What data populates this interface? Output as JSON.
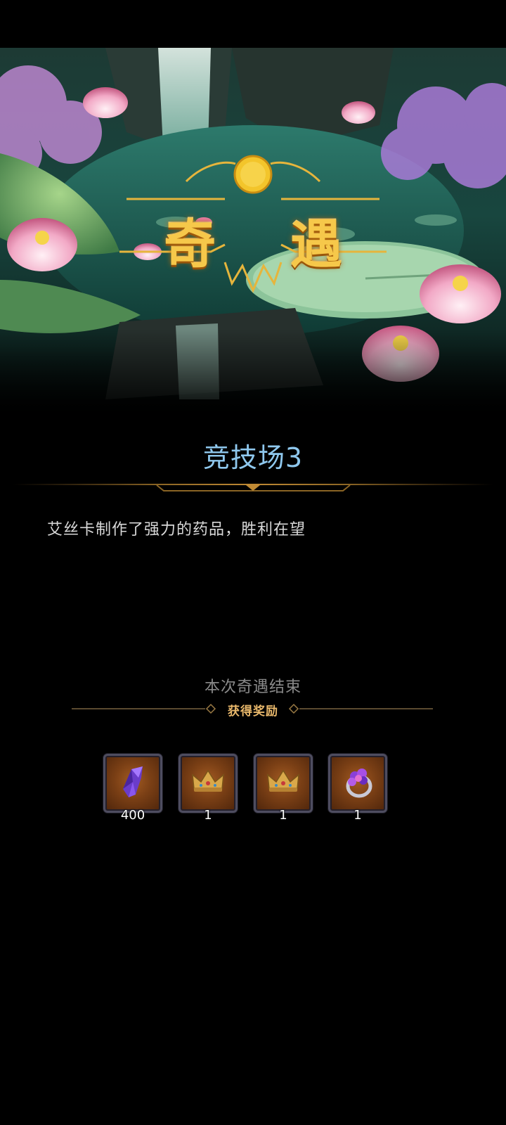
{
  "banner": {
    "emblem_title": "奇 遇"
  },
  "event": {
    "title": "竞技场3",
    "description": "艾丝卡制作了强力的药品，胜利在望"
  },
  "result": {
    "end_text": "本次奇遇结束",
    "reward_label": "获得奖励"
  },
  "rewards": [
    {
      "icon": "purple-crystal-icon",
      "count": "400"
    },
    {
      "icon": "gold-crown-icon",
      "count": "1"
    },
    {
      "icon": "gold-crown-icon",
      "count": "1"
    },
    {
      "icon": "gem-ring-icon",
      "count": "1"
    }
  ],
  "colors": {
    "title_blue": "#8fc8ee",
    "reward_gold": "#e9b86b",
    "emblem_gold": "#f6c84a"
  }
}
